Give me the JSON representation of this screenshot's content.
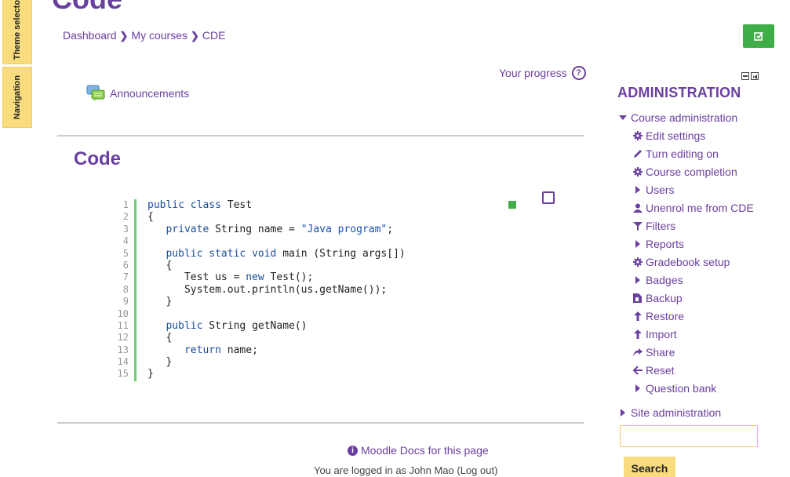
{
  "left_tabs": {
    "theme": "Theme selector",
    "navigation": "Navigation"
  },
  "page_heading": "Code",
  "breadcrumb": [
    "Dashboard",
    "My courses",
    "CDE"
  ],
  "progress_label": "Your progress",
  "announcements_label": "Announcements",
  "section_title": "Code",
  "code_lines": [
    {
      "n": "1",
      "html": "<span class='kw'>public</span> <span class='kw'>class</span> Test"
    },
    {
      "n": "2",
      "html": "{"
    },
    {
      "n": "3",
      "html": "   <span class='kw'>private</span> String name = <span class='str'>\"Java program\"</span>;"
    },
    {
      "n": "4",
      "html": ""
    },
    {
      "n": "5",
      "html": "   <span class='kw'>public</span> <span class='kw'>static</span> <span class='kw'>void</span> main (String args[])"
    },
    {
      "n": "6",
      "html": "   {"
    },
    {
      "n": "7",
      "html": "      Test us = <span class='kw'>new</span> Test();"
    },
    {
      "n": "8",
      "html": "      System.out.println(us.getName());"
    },
    {
      "n": "9",
      "html": "   }"
    },
    {
      "n": "10",
      "html": ""
    },
    {
      "n": "11",
      "html": "   <span class='kw'>public</span> String getName()"
    },
    {
      "n": "12",
      "html": "   {"
    },
    {
      "n": "13",
      "html": "      <span class='kw'>return</span> name;"
    },
    {
      "n": "14",
      "html": "   }"
    },
    {
      "n": "15",
      "html": "}"
    }
  ],
  "docs_link": "Moodle Docs for this page",
  "footer_partial": "You are logged in as John Mao (Log out)",
  "admin": {
    "title": "ADMINISTRATION",
    "course_admin": "Course administration",
    "items": [
      {
        "label": "Edit settings",
        "icon": "gear"
      },
      {
        "label": "Turn editing on",
        "icon": "pencil"
      },
      {
        "label": "Course completion",
        "icon": "gear"
      },
      {
        "label": "Users",
        "icon": "tri"
      },
      {
        "label": "Unenrol me from CDE",
        "icon": "user"
      },
      {
        "label": "Filters",
        "icon": "filter"
      },
      {
        "label": "Reports",
        "icon": "tri"
      },
      {
        "label": "Gradebook setup",
        "icon": "gear"
      },
      {
        "label": "Badges",
        "icon": "tri"
      },
      {
        "label": "Backup",
        "icon": "file"
      },
      {
        "label": "Restore",
        "icon": "upload"
      },
      {
        "label": "Import",
        "icon": "upload"
      },
      {
        "label": "Share",
        "icon": "share"
      },
      {
        "label": "Reset",
        "icon": "arrow-left"
      },
      {
        "label": "Question bank",
        "icon": "tri"
      }
    ],
    "site_admin": "Site administration"
  },
  "search": {
    "button": "Search",
    "placeholder": ""
  }
}
